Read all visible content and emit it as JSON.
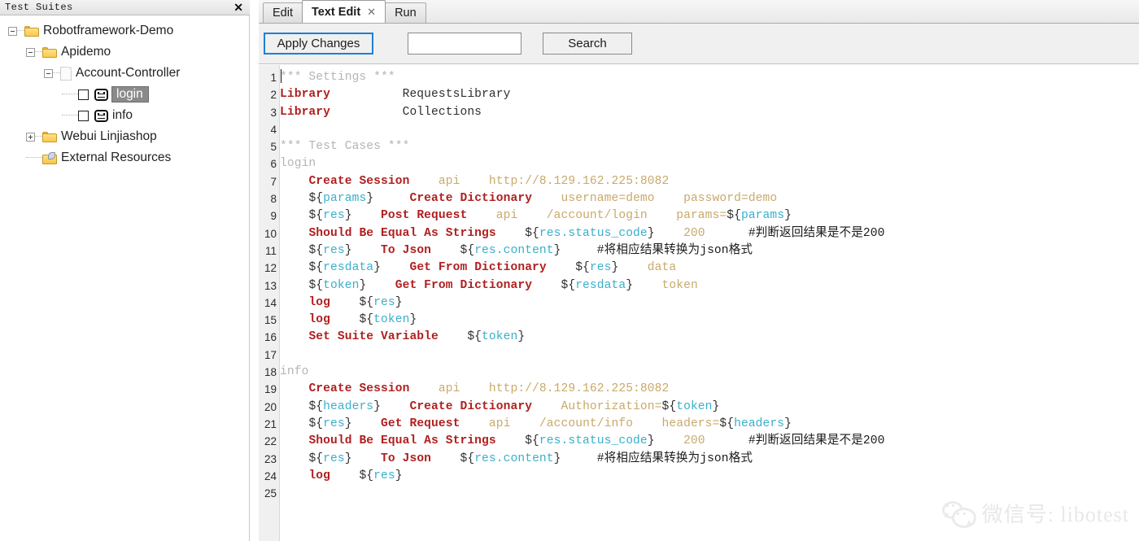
{
  "left_panel": {
    "title": "Test Suites",
    "close_icon": "✕",
    "tree": [
      {
        "label": "Robotframework-Demo",
        "icon": "folder-icon",
        "twisty": "minus",
        "depth": 0
      },
      {
        "label": "Apidemo",
        "icon": "folder-icon",
        "twisty": "minus",
        "depth": 1
      },
      {
        "label": "Account-Controller",
        "icon": "document-icon",
        "twisty": "minus",
        "depth": 2
      },
      {
        "label": "login",
        "icon": "robot-icon",
        "twisty": "none",
        "depth": 3,
        "checkbox": true,
        "selected": true
      },
      {
        "label": "info",
        "icon": "robot-icon",
        "twisty": "none",
        "depth": 3,
        "checkbox": true,
        "selected": false
      },
      {
        "label": "Webui Linjiashop",
        "icon": "folder-icon",
        "twisty": "plus",
        "depth": 1
      },
      {
        "label": "External Resources",
        "icon": "external-resources-icon",
        "twisty": "none",
        "depth": 1
      }
    ]
  },
  "right_panel": {
    "tabs": [
      {
        "label": "Edit",
        "active": false,
        "closable": false
      },
      {
        "label": "Text Edit",
        "active": true,
        "closable": true,
        "close_icon": "✕"
      },
      {
        "label": "Run",
        "active": false,
        "closable": false
      }
    ],
    "toolbar": {
      "apply_label": "Apply Changes",
      "search_value": "",
      "search_placeholder": "",
      "search_label": "Search"
    }
  },
  "editor": {
    "line_numbers": [
      1,
      2,
      3,
      4,
      5,
      6,
      7,
      8,
      9,
      10,
      11,
      12,
      13,
      14,
      15,
      16,
      17,
      18,
      19,
      20,
      21,
      22,
      23,
      24,
      25
    ],
    "lines": [
      {
        "n": 1,
        "tokens": [
          {
            "t": "*** Settings ***",
            "c": "head"
          }
        ]
      },
      {
        "n": 2,
        "tokens": [
          {
            "t": "Library",
            "c": "kw"
          },
          {
            "t": "          ",
            "c": "plain"
          },
          {
            "t": "RequestsLibrary",
            "c": "plain"
          }
        ]
      },
      {
        "n": 3,
        "tokens": [
          {
            "t": "Library",
            "c": "kw"
          },
          {
            "t": "          ",
            "c": "plain"
          },
          {
            "t": "Collections",
            "c": "plain"
          }
        ]
      },
      {
        "n": 4,
        "tokens": []
      },
      {
        "n": 5,
        "tokens": [
          {
            "t": "*** Test Cases ***",
            "c": "head"
          }
        ]
      },
      {
        "n": 6,
        "tokens": [
          {
            "t": "login",
            "c": "name"
          }
        ]
      },
      {
        "n": 7,
        "tokens": [
          {
            "t": "    ",
            "c": "plain"
          },
          {
            "t": "Create Session",
            "c": "kw"
          },
          {
            "t": "    ",
            "c": "plain"
          },
          {
            "t": "api",
            "c": "arg"
          },
          {
            "t": "    ",
            "c": "plain"
          },
          {
            "t": "http://8.129.162.225:8082",
            "c": "arg"
          }
        ]
      },
      {
        "n": 8,
        "tokens": [
          {
            "t": "    ",
            "c": "plain"
          },
          {
            "t": "${",
            "c": "varsym"
          },
          {
            "t": "params",
            "c": "var"
          },
          {
            "t": "}",
            "c": "varsym"
          },
          {
            "t": "     ",
            "c": "plain"
          },
          {
            "t": "Create Dictionary",
            "c": "kw"
          },
          {
            "t": "    ",
            "c": "plain"
          },
          {
            "t": "username=demo",
            "c": "arg"
          },
          {
            "t": "    ",
            "c": "plain"
          },
          {
            "t": "password=demo",
            "c": "arg"
          }
        ]
      },
      {
        "n": 9,
        "tokens": [
          {
            "t": "    ",
            "c": "plain"
          },
          {
            "t": "${",
            "c": "varsym"
          },
          {
            "t": "res",
            "c": "var"
          },
          {
            "t": "}",
            "c": "varsym"
          },
          {
            "t": "    ",
            "c": "plain"
          },
          {
            "t": "Post Request",
            "c": "kw"
          },
          {
            "t": "    ",
            "c": "plain"
          },
          {
            "t": "api",
            "c": "arg"
          },
          {
            "t": "    ",
            "c": "plain"
          },
          {
            "t": "/account/login",
            "c": "arg"
          },
          {
            "t": "    ",
            "c": "plain"
          },
          {
            "t": "params=",
            "c": "arg"
          },
          {
            "t": "${",
            "c": "varsym"
          },
          {
            "t": "params",
            "c": "var"
          },
          {
            "t": "}",
            "c": "varsym"
          }
        ]
      },
      {
        "n": 10,
        "tokens": [
          {
            "t": "    ",
            "c": "plain"
          },
          {
            "t": "Should Be Equal As Strings",
            "c": "kw"
          },
          {
            "t": "    ",
            "c": "plain"
          },
          {
            "t": "${",
            "c": "varsym"
          },
          {
            "t": "res.status_code",
            "c": "var"
          },
          {
            "t": "}",
            "c": "varsym"
          },
          {
            "t": "    ",
            "c": "plain"
          },
          {
            "t": "200",
            "c": "arg"
          },
          {
            "t": "      ",
            "c": "plain"
          },
          {
            "t": "#判断返回结果是不是200",
            "c": "cmt"
          }
        ]
      },
      {
        "n": 11,
        "tokens": [
          {
            "t": "    ",
            "c": "plain"
          },
          {
            "t": "${",
            "c": "varsym"
          },
          {
            "t": "res",
            "c": "var"
          },
          {
            "t": "}",
            "c": "varsym"
          },
          {
            "t": "    ",
            "c": "plain"
          },
          {
            "t": "To Json",
            "c": "kw"
          },
          {
            "t": "    ",
            "c": "plain"
          },
          {
            "t": "${",
            "c": "varsym"
          },
          {
            "t": "res.content",
            "c": "var"
          },
          {
            "t": "}",
            "c": "varsym"
          },
          {
            "t": "     ",
            "c": "plain"
          },
          {
            "t": "#将相应结果转换为json格式",
            "c": "cmt"
          }
        ]
      },
      {
        "n": 12,
        "tokens": [
          {
            "t": "    ",
            "c": "plain"
          },
          {
            "t": "${",
            "c": "varsym"
          },
          {
            "t": "resdata",
            "c": "var"
          },
          {
            "t": "}",
            "c": "varsym"
          },
          {
            "t": "    ",
            "c": "plain"
          },
          {
            "t": "Get From Dictionary",
            "c": "kw"
          },
          {
            "t": "    ",
            "c": "plain"
          },
          {
            "t": "${",
            "c": "varsym"
          },
          {
            "t": "res",
            "c": "var"
          },
          {
            "t": "}",
            "c": "varsym"
          },
          {
            "t": "    ",
            "c": "plain"
          },
          {
            "t": "data",
            "c": "arg"
          }
        ]
      },
      {
        "n": 13,
        "tokens": [
          {
            "t": "    ",
            "c": "plain"
          },
          {
            "t": "${",
            "c": "varsym"
          },
          {
            "t": "token",
            "c": "var"
          },
          {
            "t": "}",
            "c": "varsym"
          },
          {
            "t": "    ",
            "c": "plain"
          },
          {
            "t": "Get From Dictionary",
            "c": "kw"
          },
          {
            "t": "    ",
            "c": "plain"
          },
          {
            "t": "${",
            "c": "varsym"
          },
          {
            "t": "resdata",
            "c": "var"
          },
          {
            "t": "}",
            "c": "varsym"
          },
          {
            "t": "    ",
            "c": "plain"
          },
          {
            "t": "token",
            "c": "arg"
          }
        ]
      },
      {
        "n": 14,
        "tokens": [
          {
            "t": "    ",
            "c": "plain"
          },
          {
            "t": "log",
            "c": "kw"
          },
          {
            "t": "    ",
            "c": "plain"
          },
          {
            "t": "${",
            "c": "varsym"
          },
          {
            "t": "res",
            "c": "var"
          },
          {
            "t": "}",
            "c": "varsym"
          }
        ]
      },
      {
        "n": 15,
        "tokens": [
          {
            "t": "    ",
            "c": "plain"
          },
          {
            "t": "log",
            "c": "kw"
          },
          {
            "t": "    ",
            "c": "plain"
          },
          {
            "t": "${",
            "c": "varsym"
          },
          {
            "t": "token",
            "c": "var"
          },
          {
            "t": "}",
            "c": "varsym"
          }
        ]
      },
      {
        "n": 16,
        "tokens": [
          {
            "t": "    ",
            "c": "plain"
          },
          {
            "t": "Set Suite Variable",
            "c": "kw"
          },
          {
            "t": "    ",
            "c": "plain"
          },
          {
            "t": "${",
            "c": "varsym"
          },
          {
            "t": "token",
            "c": "var"
          },
          {
            "t": "}",
            "c": "varsym"
          }
        ]
      },
      {
        "n": 17,
        "tokens": []
      },
      {
        "n": 18,
        "tokens": [
          {
            "t": "info",
            "c": "name"
          }
        ]
      },
      {
        "n": 19,
        "tokens": [
          {
            "t": "    ",
            "c": "plain"
          },
          {
            "t": "Create Session",
            "c": "kw"
          },
          {
            "t": "    ",
            "c": "plain"
          },
          {
            "t": "api",
            "c": "arg"
          },
          {
            "t": "    ",
            "c": "plain"
          },
          {
            "t": "http://8.129.162.225:8082",
            "c": "arg"
          }
        ]
      },
      {
        "n": 20,
        "tokens": [
          {
            "t": "    ",
            "c": "plain"
          },
          {
            "t": "${",
            "c": "varsym"
          },
          {
            "t": "headers",
            "c": "var"
          },
          {
            "t": "}",
            "c": "varsym"
          },
          {
            "t": "    ",
            "c": "plain"
          },
          {
            "t": "Create Dictionary",
            "c": "kw"
          },
          {
            "t": "    ",
            "c": "plain"
          },
          {
            "t": "Authorization=",
            "c": "arg"
          },
          {
            "t": "${",
            "c": "varsym"
          },
          {
            "t": "token",
            "c": "var"
          },
          {
            "t": "}",
            "c": "varsym"
          }
        ]
      },
      {
        "n": 21,
        "tokens": [
          {
            "t": "    ",
            "c": "plain"
          },
          {
            "t": "${",
            "c": "varsym"
          },
          {
            "t": "res",
            "c": "var"
          },
          {
            "t": "}",
            "c": "varsym"
          },
          {
            "t": "    ",
            "c": "plain"
          },
          {
            "t": "Get Request",
            "c": "kw"
          },
          {
            "t": "    ",
            "c": "plain"
          },
          {
            "t": "api",
            "c": "arg"
          },
          {
            "t": "    ",
            "c": "plain"
          },
          {
            "t": "/account/info",
            "c": "arg"
          },
          {
            "t": "    ",
            "c": "plain"
          },
          {
            "t": "headers=",
            "c": "arg"
          },
          {
            "t": "${",
            "c": "varsym"
          },
          {
            "t": "headers",
            "c": "var"
          },
          {
            "t": "}",
            "c": "varsym"
          }
        ]
      },
      {
        "n": 22,
        "tokens": [
          {
            "t": "    ",
            "c": "plain"
          },
          {
            "t": "Should Be Equal As Strings",
            "c": "kw"
          },
          {
            "t": "    ",
            "c": "plain"
          },
          {
            "t": "${",
            "c": "varsym"
          },
          {
            "t": "res.status_code",
            "c": "var"
          },
          {
            "t": "}",
            "c": "varsym"
          },
          {
            "t": "    ",
            "c": "plain"
          },
          {
            "t": "200",
            "c": "arg"
          },
          {
            "t": "      ",
            "c": "plain"
          },
          {
            "t": "#判断返回结果是不是200",
            "c": "cmt"
          }
        ]
      },
      {
        "n": 23,
        "tokens": [
          {
            "t": "    ",
            "c": "plain"
          },
          {
            "t": "${",
            "c": "varsym"
          },
          {
            "t": "res",
            "c": "var"
          },
          {
            "t": "}",
            "c": "varsym"
          },
          {
            "t": "    ",
            "c": "plain"
          },
          {
            "t": "To Json",
            "c": "kw"
          },
          {
            "t": "    ",
            "c": "plain"
          },
          {
            "t": "${",
            "c": "varsym"
          },
          {
            "t": "res.content",
            "c": "var"
          },
          {
            "t": "}",
            "c": "varsym"
          },
          {
            "t": "     ",
            "c": "plain"
          },
          {
            "t": "#将相应结果转换为json格式",
            "c": "cmt"
          }
        ]
      },
      {
        "n": 24,
        "tokens": [
          {
            "t": "    ",
            "c": "plain"
          },
          {
            "t": "log",
            "c": "kw"
          },
          {
            "t": "    ",
            "c": "plain"
          },
          {
            "t": "${",
            "c": "varsym"
          },
          {
            "t": "res",
            "c": "var"
          },
          {
            "t": "}",
            "c": "varsym"
          }
        ]
      },
      {
        "n": 25,
        "tokens": []
      }
    ]
  },
  "watermark": {
    "text": "微信号: libotest",
    "logo": "wechat-icon"
  },
  "colors": {
    "keyword": "#b02020",
    "variable": "#39b0c9",
    "argument": "#c9a96a",
    "header": "#b5b5b5",
    "accent_focus": "#1f7fd6",
    "selection": "#8a8a8a"
  }
}
